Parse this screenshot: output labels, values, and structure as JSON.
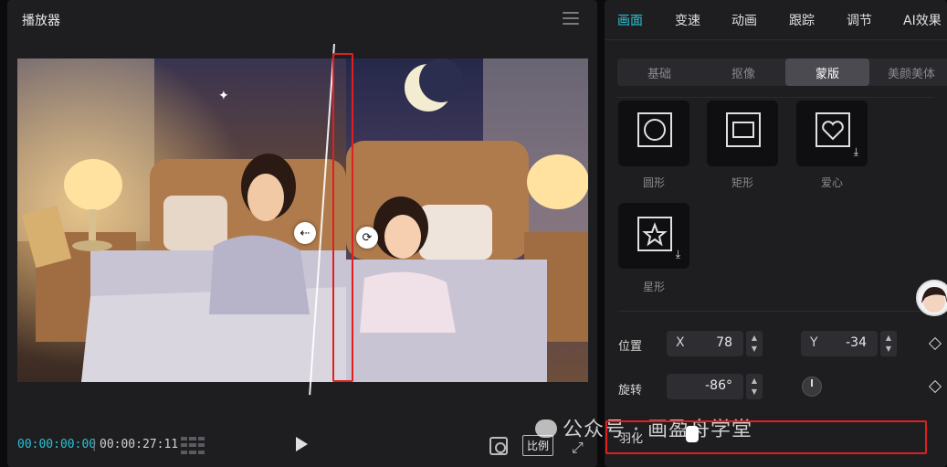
{
  "player": {
    "title": "播放器",
    "timecode_current": "00:00:00:00",
    "timecode_total": "00:00:27:11",
    "ratio_label": "比例"
  },
  "panel": {
    "tabs": [
      "画面",
      "变速",
      "动画",
      "跟踪",
      "调节",
      "AI效果"
    ],
    "active_tab": "画面",
    "sub_tabs": [
      "基础",
      "抠像",
      "蒙版",
      "美颜美体"
    ],
    "active_sub_tab": "蒙版",
    "shapes": [
      {
        "label": "圆形",
        "icon": "circle-icon",
        "download": false
      },
      {
        "label": "矩形",
        "icon": "rectangle-icon",
        "download": false
      },
      {
        "label": "爱心",
        "icon": "heart-icon",
        "download": true
      },
      {
        "label": "星形",
        "icon": "star-icon",
        "download": true
      }
    ],
    "position": {
      "label": "位置",
      "x_axis": "X",
      "x_value": "78",
      "y_axis": "Y",
      "y_value": "-34"
    },
    "rotation": {
      "label": "旋转",
      "value": "-86°"
    },
    "feather": {
      "label": "羽化"
    }
  },
  "watermark": "公众号 · 画盈舟学堂",
  "colors": {
    "accent": "#27c4d6",
    "highlight_box": "#e02020"
  }
}
